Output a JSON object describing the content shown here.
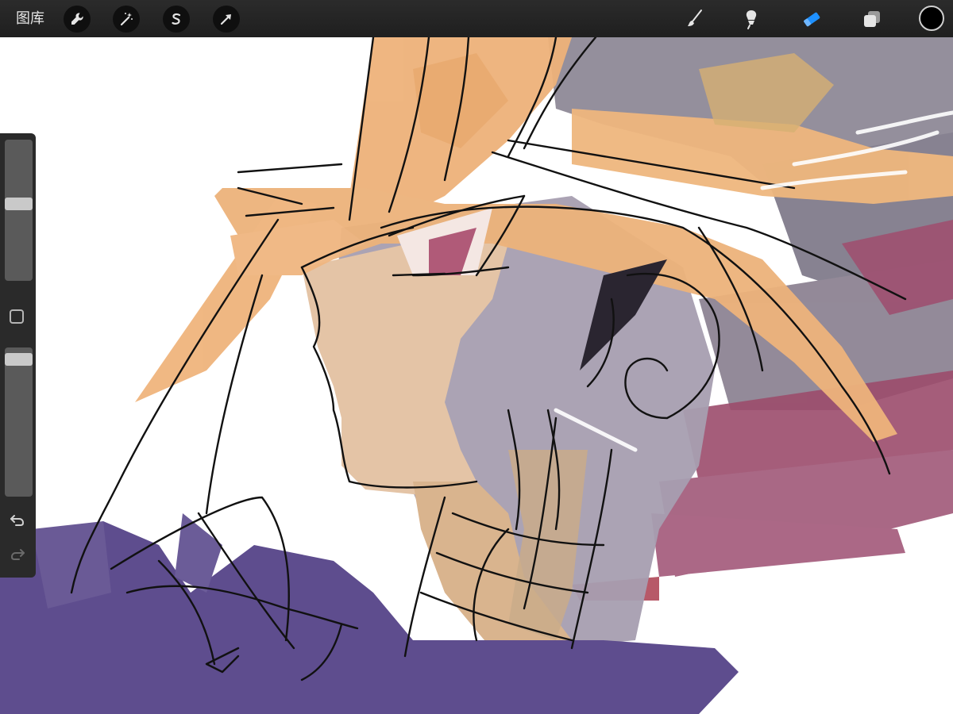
{
  "toolbar": {
    "gallery_label": "图库",
    "left_tools": [
      {
        "name": "actions",
        "icon": "wrench-icon"
      },
      {
        "name": "adjustments",
        "icon": "magic-wand-icon"
      },
      {
        "name": "selection",
        "icon": "selection-s-icon"
      },
      {
        "name": "transform",
        "icon": "arrow-cursor-icon"
      }
    ],
    "right_tools": [
      {
        "name": "brush",
        "icon": "brush-icon",
        "active": false
      },
      {
        "name": "smudge",
        "icon": "smudge-icon",
        "active": false
      },
      {
        "name": "eraser",
        "icon": "eraser-icon",
        "active": true
      },
      {
        "name": "layers",
        "icon": "layers-icon",
        "active": false
      }
    ],
    "current_color": "#000000",
    "active_tool_color": "#1e90ff"
  },
  "sidebar": {
    "brush_size_level": 0.55,
    "brush_opacity_level": 0.96,
    "modify_icon": "square-modify-icon",
    "undo_icon": "undo-icon",
    "redo_icon": "redo-icon",
    "redo_enabled": false
  },
  "canvas": {
    "background": "#ffffff",
    "palette": {
      "hair": "#eeb27a",
      "skin": "#e6c2a0",
      "shadow": "#9a8fa0",
      "gray": "#8a8592",
      "jacket": "#5e4d8e",
      "magenta": "#9c4c6c",
      "line": "#111111"
    }
  }
}
